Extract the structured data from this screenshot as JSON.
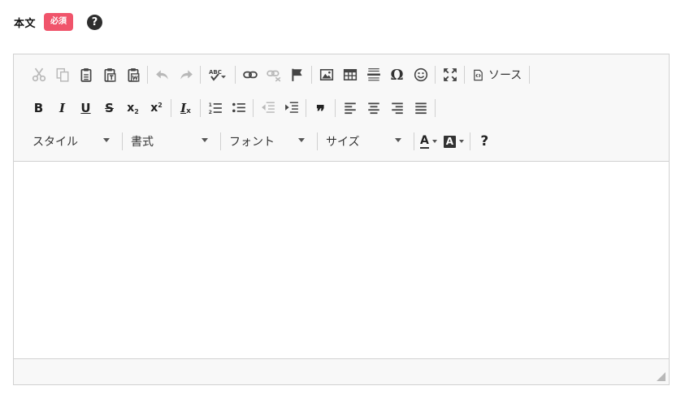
{
  "field": {
    "label": "本文",
    "required_badge": "必須",
    "help_glyph": "?"
  },
  "toolbar": {
    "row1": [
      "cut-icon",
      "copy-icon",
      "paste-icon",
      "paste-text-icon",
      "paste-word-icon",
      "undo-icon",
      "redo-icon",
      "spellcheck-icon",
      "link-icon",
      "unlink-icon",
      "anchor-icon",
      "image-icon",
      "table-icon",
      "horizontal-rule-icon",
      "special-char-icon",
      "smiley-icon",
      "maximize-icon",
      "source-icon"
    ],
    "source_label": "ソース",
    "bold_label": "B",
    "italic_label": "I",
    "underline_label": "U",
    "strike_label": "S",
    "subscript_label": "x",
    "superscript_label": "x",
    "remove_format_label": "I",
    "blockquote_label": "❞",
    "style_combo": "スタイル",
    "format_combo": "書式",
    "font_combo": "フォント",
    "size_combo": "サイズ",
    "text_color_label": "A",
    "bg_color_label": "A",
    "about_label": "?"
  },
  "colors": {
    "badge": "#f0546b",
    "toolbar_bg": "#f8f8f8",
    "border": "#d1d1d1",
    "icon": "#444444"
  }
}
